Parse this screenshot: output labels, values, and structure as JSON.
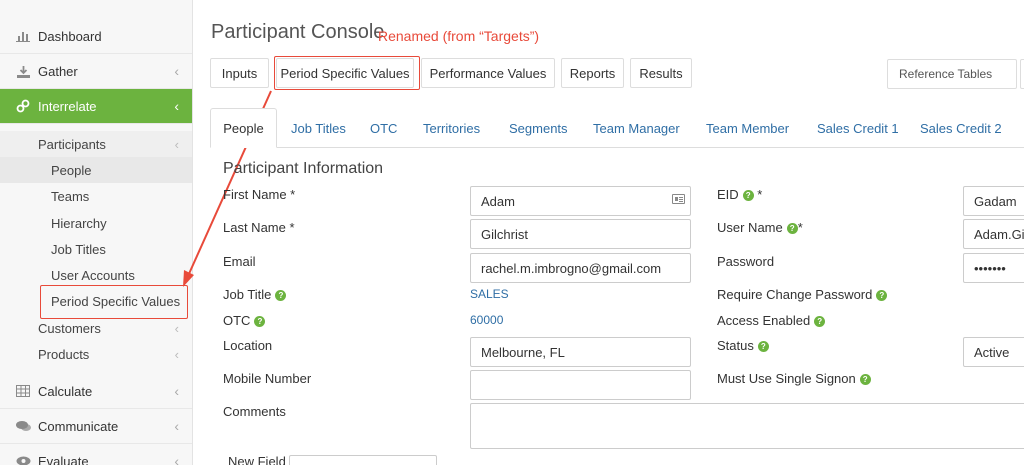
{
  "sidebar": {
    "items": [
      {
        "label": "Dashboard",
        "icon": "bar-chart-icon"
      },
      {
        "label": "Gather",
        "icon": "download-icon"
      },
      {
        "label": "Interrelate",
        "icon": "link-icon"
      },
      {
        "label": "Calculate",
        "icon": "table-icon"
      },
      {
        "label": "Communicate",
        "icon": "chat-icon"
      },
      {
        "label": "Evaluate",
        "icon": "eye-icon"
      }
    ],
    "sub": {
      "participants": "Participants",
      "people": "People",
      "teams": "Teams",
      "hierarchy": "Hierarchy",
      "job_titles": "Job Titles",
      "user_accounts": "User Accounts",
      "period_specific_values": "Period Specific Values",
      "customers": "Customers",
      "products": "Products"
    },
    "chevron": "‹",
    "active_color": "#6cb33f"
  },
  "header": {
    "title": "Participant Console",
    "annotation": "Renamed (from “Targets”)"
  },
  "top_tabs": [
    "Inputs",
    "Period Specific Values",
    "Performance Values",
    "Reports",
    "Results"
  ],
  "reference_tables": "Reference Tables",
  "sub_tabs": [
    "People",
    "Job Titles",
    "OTC",
    "Territories",
    "Segments",
    "Team Manager",
    "Team Member",
    "Sales Credit 1",
    "Sales Credit 2"
  ],
  "form": {
    "section_title": "Participant Information",
    "first_name_label": "First Name *",
    "first_name": "Adam",
    "last_name_label": "Last Name *",
    "last_name": "Gilchrist",
    "email_label": "Email",
    "email": "rachel.m.imbrogno@gmail.com",
    "job_title_label": "Job Title",
    "job_title": "SALES",
    "otc_label": "OTC",
    "otc": "60000",
    "location_label": "Location",
    "location": "Melbourne, FL",
    "mobile_label": "Mobile Number",
    "mobile": "",
    "comments_label": "Comments",
    "comments": "",
    "new_field_label": "New Field",
    "eid_label": "EID",
    "eid": "Gadam",
    "username_label": "User Name",
    "username": "Adam.Gil",
    "password_label": "Password",
    "password": "•••••••",
    "require_change_label": "Require Change Password",
    "access_enabled_label": "Access Enabled",
    "status_label": "Status",
    "status": "Active",
    "single_signon_label": "Must Use Single Signon",
    "required_mark": "*",
    "help_glyph": "?"
  },
  "colors": {
    "accent_green": "#6cb33f",
    "link_blue": "#2f6ea5",
    "annotation_red": "#e84a3a"
  }
}
